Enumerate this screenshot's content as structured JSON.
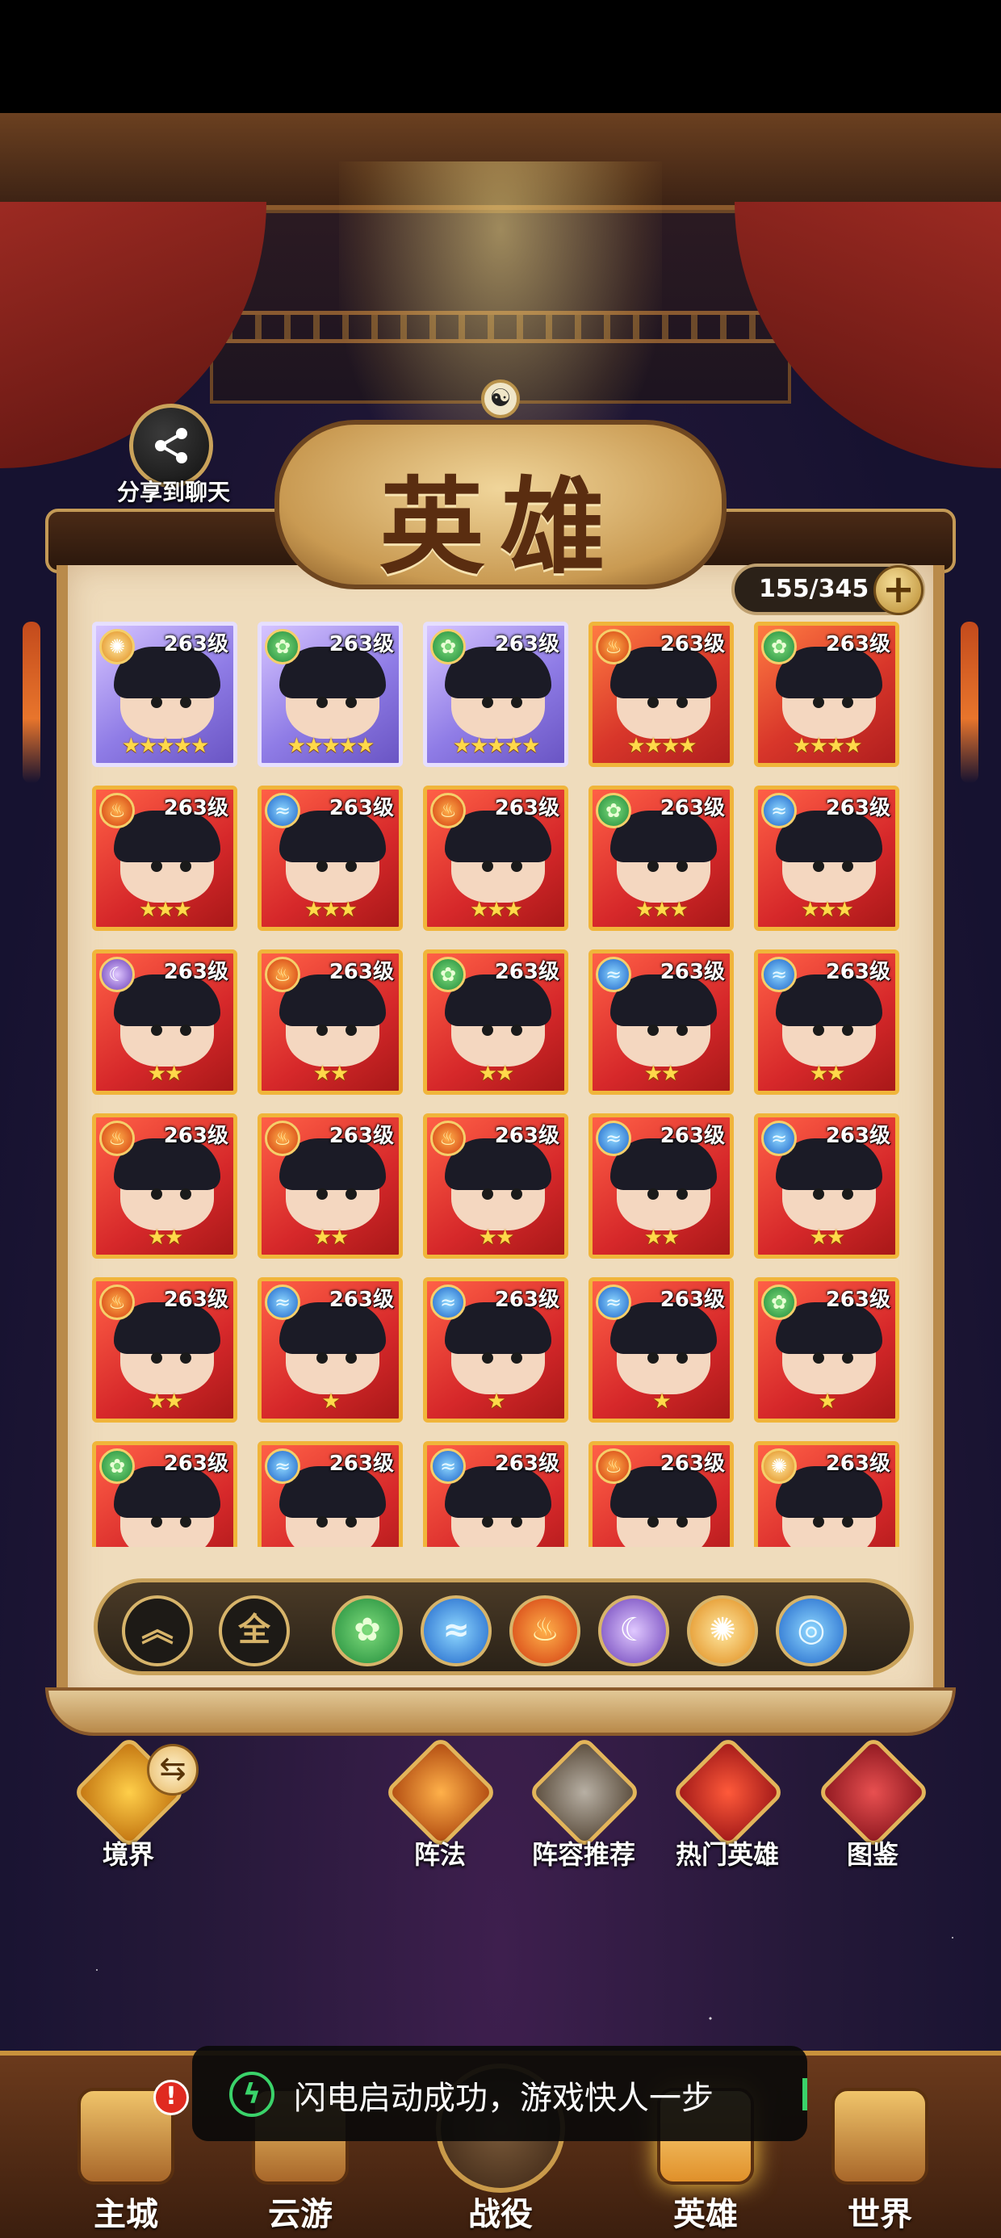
{
  "share": {
    "label": "分享到聊天",
    "icon": "share-icon"
  },
  "title": "英雄",
  "roster": {
    "count": "155/345",
    "add_icon": "plus-icon"
  },
  "heroes": [
    {
      "frame": "purple",
      "element": "sun",
      "level": "263级",
      "stars": "★★★★★"
    },
    {
      "frame": "purple",
      "element": "wood",
      "level": "263级",
      "stars": "★★★★★"
    },
    {
      "frame": "purple",
      "element": "wood",
      "level": "263级",
      "stars": "★★★★★"
    },
    {
      "frame": "gold",
      "element": "fire",
      "level": "263级",
      "stars": "★★★★"
    },
    {
      "frame": "gold",
      "element": "wood",
      "level": "263级",
      "stars": "★★★★"
    },
    {
      "frame": "red",
      "element": "fire",
      "level": "263级",
      "stars": "★★★"
    },
    {
      "frame": "red",
      "element": "water",
      "level": "263级",
      "stars": "★★★"
    },
    {
      "frame": "red",
      "element": "fire",
      "level": "263级",
      "stars": "★★★"
    },
    {
      "frame": "red",
      "element": "wood",
      "level": "263级",
      "stars": "★★★"
    },
    {
      "frame": "red",
      "element": "water",
      "level": "263级",
      "stars": "★★★"
    },
    {
      "frame": "red",
      "element": "moon",
      "level": "263级",
      "stars": "★★"
    },
    {
      "frame": "red",
      "element": "fire",
      "level": "263级",
      "stars": "★★"
    },
    {
      "frame": "red",
      "element": "wood",
      "level": "263级",
      "stars": "★★"
    },
    {
      "frame": "red",
      "element": "water",
      "level": "263级",
      "stars": "★★"
    },
    {
      "frame": "red",
      "element": "water",
      "level": "263级",
      "stars": "★★"
    },
    {
      "frame": "red",
      "element": "fire",
      "level": "263级",
      "stars": "★★"
    },
    {
      "frame": "red",
      "element": "fire",
      "level": "263级",
      "stars": "★★"
    },
    {
      "frame": "red",
      "element": "fire",
      "level": "263级",
      "stars": "★★"
    },
    {
      "frame": "red",
      "element": "water",
      "level": "263级",
      "stars": "★★"
    },
    {
      "frame": "red",
      "element": "water",
      "level": "263级",
      "stars": "★★"
    },
    {
      "frame": "red",
      "element": "fire",
      "level": "263级",
      "stars": "★★"
    },
    {
      "frame": "red",
      "element": "water",
      "level": "263级",
      "stars": "★"
    },
    {
      "frame": "red",
      "element": "water",
      "level": "263级",
      "stars": "★"
    },
    {
      "frame": "red",
      "element": "water",
      "level": "263级",
      "stars": "★"
    },
    {
      "frame": "red",
      "element": "wood",
      "level": "263级",
      "stars": "★"
    },
    {
      "frame": "red",
      "element": "wood",
      "level": "263级",
      "stars": ""
    },
    {
      "frame": "red",
      "element": "water",
      "level": "263级",
      "stars": ""
    },
    {
      "frame": "red",
      "element": "water",
      "level": "263级",
      "stars": ""
    },
    {
      "frame": "red",
      "element": "fire",
      "level": "263级",
      "stars": ""
    },
    {
      "frame": "red",
      "element": "sun",
      "level": "263级",
      "stars": ""
    }
  ],
  "filters": {
    "sort_icon": "double-chevron-up-icon",
    "all_label": "全",
    "elements": [
      "wood",
      "water",
      "fire",
      "moon",
      "sun",
      "vortex"
    ]
  },
  "dock": {
    "realm": "境界",
    "formation": "阵法",
    "lineup": "阵容推荐",
    "hot_heroes": "热门英雄",
    "codex": "图鉴"
  },
  "bottom_nav": {
    "main_city": "主城",
    "travel": "云游",
    "battle": "战役",
    "heroes": "英雄",
    "world": "世界",
    "alert_badge": "!"
  },
  "toast": {
    "message": "闪电启动成功，游戏快人一步"
  },
  "colors": {
    "frame_gold": "#f0b53a",
    "frame_purple": "#e6dfff",
    "panel_parchment": "#efdcbc",
    "toast_green": "#3ad36a"
  }
}
